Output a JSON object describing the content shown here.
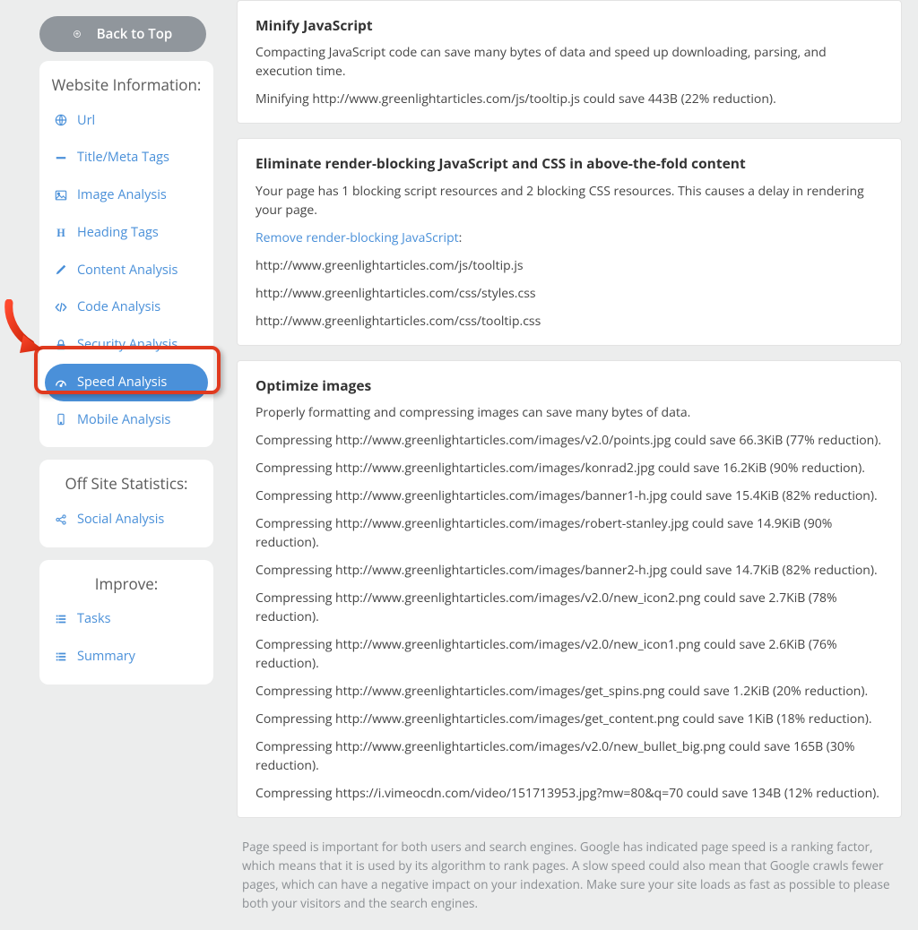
{
  "sidebar": {
    "back_to_top": "Back to Top",
    "groups": [
      {
        "heading": "Website Information:",
        "items": [
          {
            "icon": "globe-icon",
            "label": "Url",
            "active": false
          },
          {
            "icon": "hyphen-icon",
            "label": "Title/Meta Tags",
            "active": false
          },
          {
            "icon": "image-icon",
            "label": "Image Analysis",
            "active": false
          },
          {
            "icon": "h-icon",
            "label": "Heading Tags",
            "active": false
          },
          {
            "icon": "pencil-icon",
            "label": "Content Analysis",
            "active": false
          },
          {
            "icon": "code-icon",
            "label": "Code Analysis",
            "active": false
          },
          {
            "icon": "lock-icon",
            "label": "Security Analysis",
            "active": false
          },
          {
            "icon": "gauge-icon",
            "label": "Speed Analysis",
            "active": true
          },
          {
            "icon": "mobile-icon",
            "label": "Mobile Analysis",
            "active": false
          }
        ]
      },
      {
        "heading": "Off Site Statistics:",
        "items": [
          {
            "icon": "share-icon",
            "label": "Social Analysis",
            "active": false
          }
        ]
      },
      {
        "heading": "Improve:",
        "items": [
          {
            "icon": "list-icon",
            "label": "Tasks",
            "active": false
          },
          {
            "icon": "list-icon",
            "label": "Summary",
            "active": false
          }
        ]
      }
    ]
  },
  "panels": [
    {
      "heading": "Minify JavaScript",
      "blocks": [
        {
          "type": "text",
          "value": "Compacting JavaScript code can save many bytes of data and speed up downloading, parsing, and execution time."
        },
        {
          "type": "text",
          "value": "Minifying http://www.greenlightarticles.com/js/tooltip.js could save 443B (22% reduction)."
        }
      ]
    },
    {
      "heading": "Eliminate render-blocking JavaScript and CSS in above-the-fold content",
      "blocks": [
        {
          "type": "text",
          "value": "Your page has 1 blocking script resources and 2 blocking CSS resources. This causes a delay in rendering your page."
        },
        {
          "type": "link_colon",
          "link_text": "Remove render-blocking JavaScript",
          "suffix": ":"
        },
        {
          "type": "text",
          "value": "http://www.greenlightarticles.com/js/tooltip.js"
        },
        {
          "type": "text",
          "value": "http://www.greenlightarticles.com/css/styles.css"
        },
        {
          "type": "text",
          "value": "http://www.greenlightarticles.com/css/tooltip.css"
        }
      ]
    },
    {
      "heading": "Optimize images",
      "blocks": [
        {
          "type": "text",
          "value": "Properly formatting and compressing images can save many bytes of data."
        },
        {
          "type": "text",
          "value": "Compressing http://www.greenlightarticles.com/images/v2.0/points.jpg could save 66.3KiB (77% reduction)."
        },
        {
          "type": "text",
          "value": "Compressing http://www.greenlightarticles.com/images/konrad2.jpg could save 16.2KiB (90% reduction)."
        },
        {
          "type": "text",
          "value": "Compressing http://www.greenlightarticles.com/images/banner1-h.jpg could save 15.4KiB (82% reduction)."
        },
        {
          "type": "text",
          "value": "Compressing http://www.greenlightarticles.com/images/robert-stanley.jpg could save 14.9KiB (90% reduction)."
        },
        {
          "type": "text",
          "value": "Compressing http://www.greenlightarticles.com/images/banner2-h.jpg could save 14.7KiB (82% reduction)."
        },
        {
          "type": "text",
          "value": "Compressing http://www.greenlightarticles.com/images/v2.0/new_icon2.png could save 2.7KiB (78% reduction)."
        },
        {
          "type": "text",
          "value": "Compressing http://www.greenlightarticles.com/images/v2.0/new_icon1.png could save 2.6KiB (76% reduction)."
        },
        {
          "type": "text",
          "value": "Compressing http://www.greenlightarticles.com/images/get_spins.png could save 1.2KiB (20% reduction)."
        },
        {
          "type": "text",
          "value": "Compressing http://www.greenlightarticles.com/images/get_content.png could save 1KiB (18% reduction)."
        },
        {
          "type": "text",
          "value": "Compressing http://www.greenlightarticles.com/images/v2.0/new_bullet_big.png could save 165B (30% reduction)."
        },
        {
          "type": "text",
          "value": "Compressing https://i.vimeocdn.com/video/151713953.jpg?mw=80&q=70 could save 134B (12% reduction)."
        }
      ]
    }
  ],
  "footer_note": "Page speed is important for both users and search engines. Google has indicated page speed is a ranking factor, which means that it is used by its algorithm to rank pages. A slow speed could also mean that Google crawls fewer pages, which can have a negative impact on your indexation. Make sure your site loads as fast as possible to please both your visitors and the search engines."
}
